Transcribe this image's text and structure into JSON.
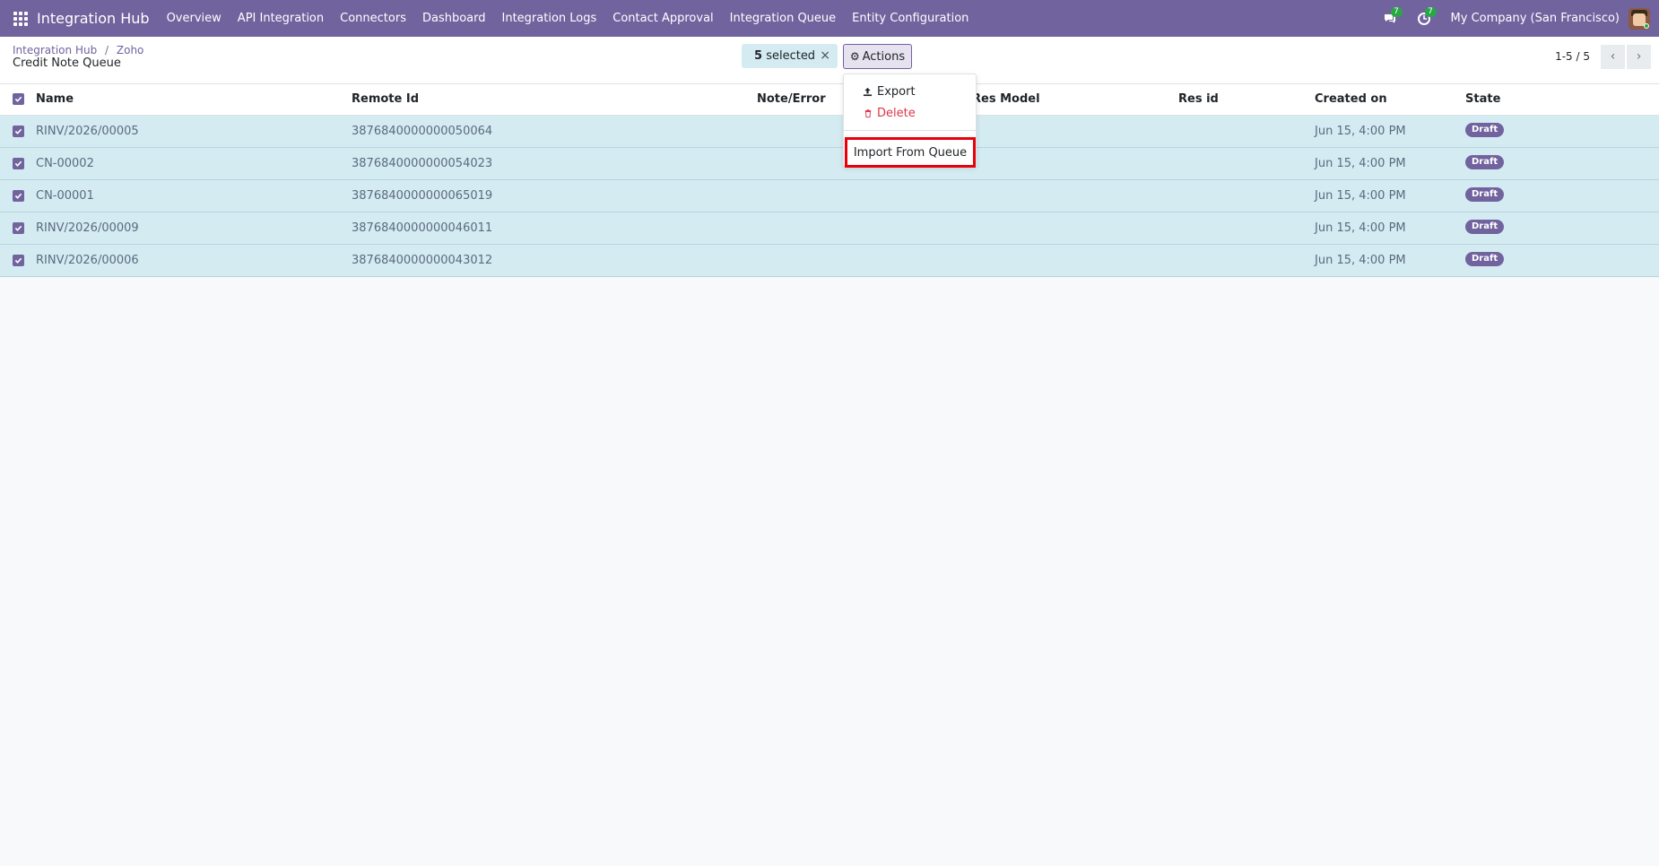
{
  "navbar": {
    "brand": "Integration Hub",
    "menu": [
      "Overview",
      "API Integration",
      "Connectors",
      "Dashboard",
      "Integration Logs",
      "Contact Approval",
      "Integration Queue",
      "Entity Configuration"
    ],
    "messages_count": "7",
    "activities_count": "7",
    "company": "My Company (San Francisco)",
    "bg_color": "#71639e"
  },
  "breadcrumb": {
    "items": [
      "Integration Hub",
      "Zoho"
    ],
    "separator": "/",
    "current": "Credit Note Queue"
  },
  "selection": {
    "count": "5",
    "label": "selected",
    "clear_icon": "×"
  },
  "actions": {
    "label": "Actions",
    "icon": "gear-icon",
    "menu": {
      "export": "Export",
      "delete": "Delete",
      "import": "Import From Queue"
    }
  },
  "pager": {
    "value": "1-5 / 5",
    "prev_icon": "chevron-left-icon",
    "next_icon": "chevron-right-icon"
  },
  "table": {
    "columns": [
      "Name",
      "Remote Id",
      "Note/Error",
      "Res Model",
      "Res id",
      "Created on",
      "State"
    ],
    "rows": [
      {
        "name": "RINV/2026/00005",
        "remote_id": "3876840000000050064",
        "note": "",
        "res_model": "",
        "res_id": "",
        "created_on": "Jun 15, 4:00 PM",
        "state": "Draft"
      },
      {
        "name": "CN-00002",
        "remote_id": "3876840000000054023",
        "note": "",
        "res_model": "",
        "res_id": "",
        "created_on": "Jun 15, 4:00 PM",
        "state": "Draft"
      },
      {
        "name": "CN-00001",
        "remote_id": "3876840000000065019",
        "note": "",
        "res_model": "",
        "res_id": "",
        "created_on": "Jun 15, 4:00 PM",
        "state": "Draft"
      },
      {
        "name": "RINV/2026/00009",
        "remote_id": "3876840000000046011",
        "note": "",
        "res_model": "",
        "res_id": "",
        "created_on": "Jun 15, 4:00 PM",
        "state": "Draft"
      },
      {
        "name": "RINV/2026/00006",
        "remote_id": "3876840000000043012",
        "note": "",
        "res_model": "",
        "res_id": "",
        "created_on": "Jun 15, 4:00 PM",
        "state": "Draft"
      }
    ]
  }
}
